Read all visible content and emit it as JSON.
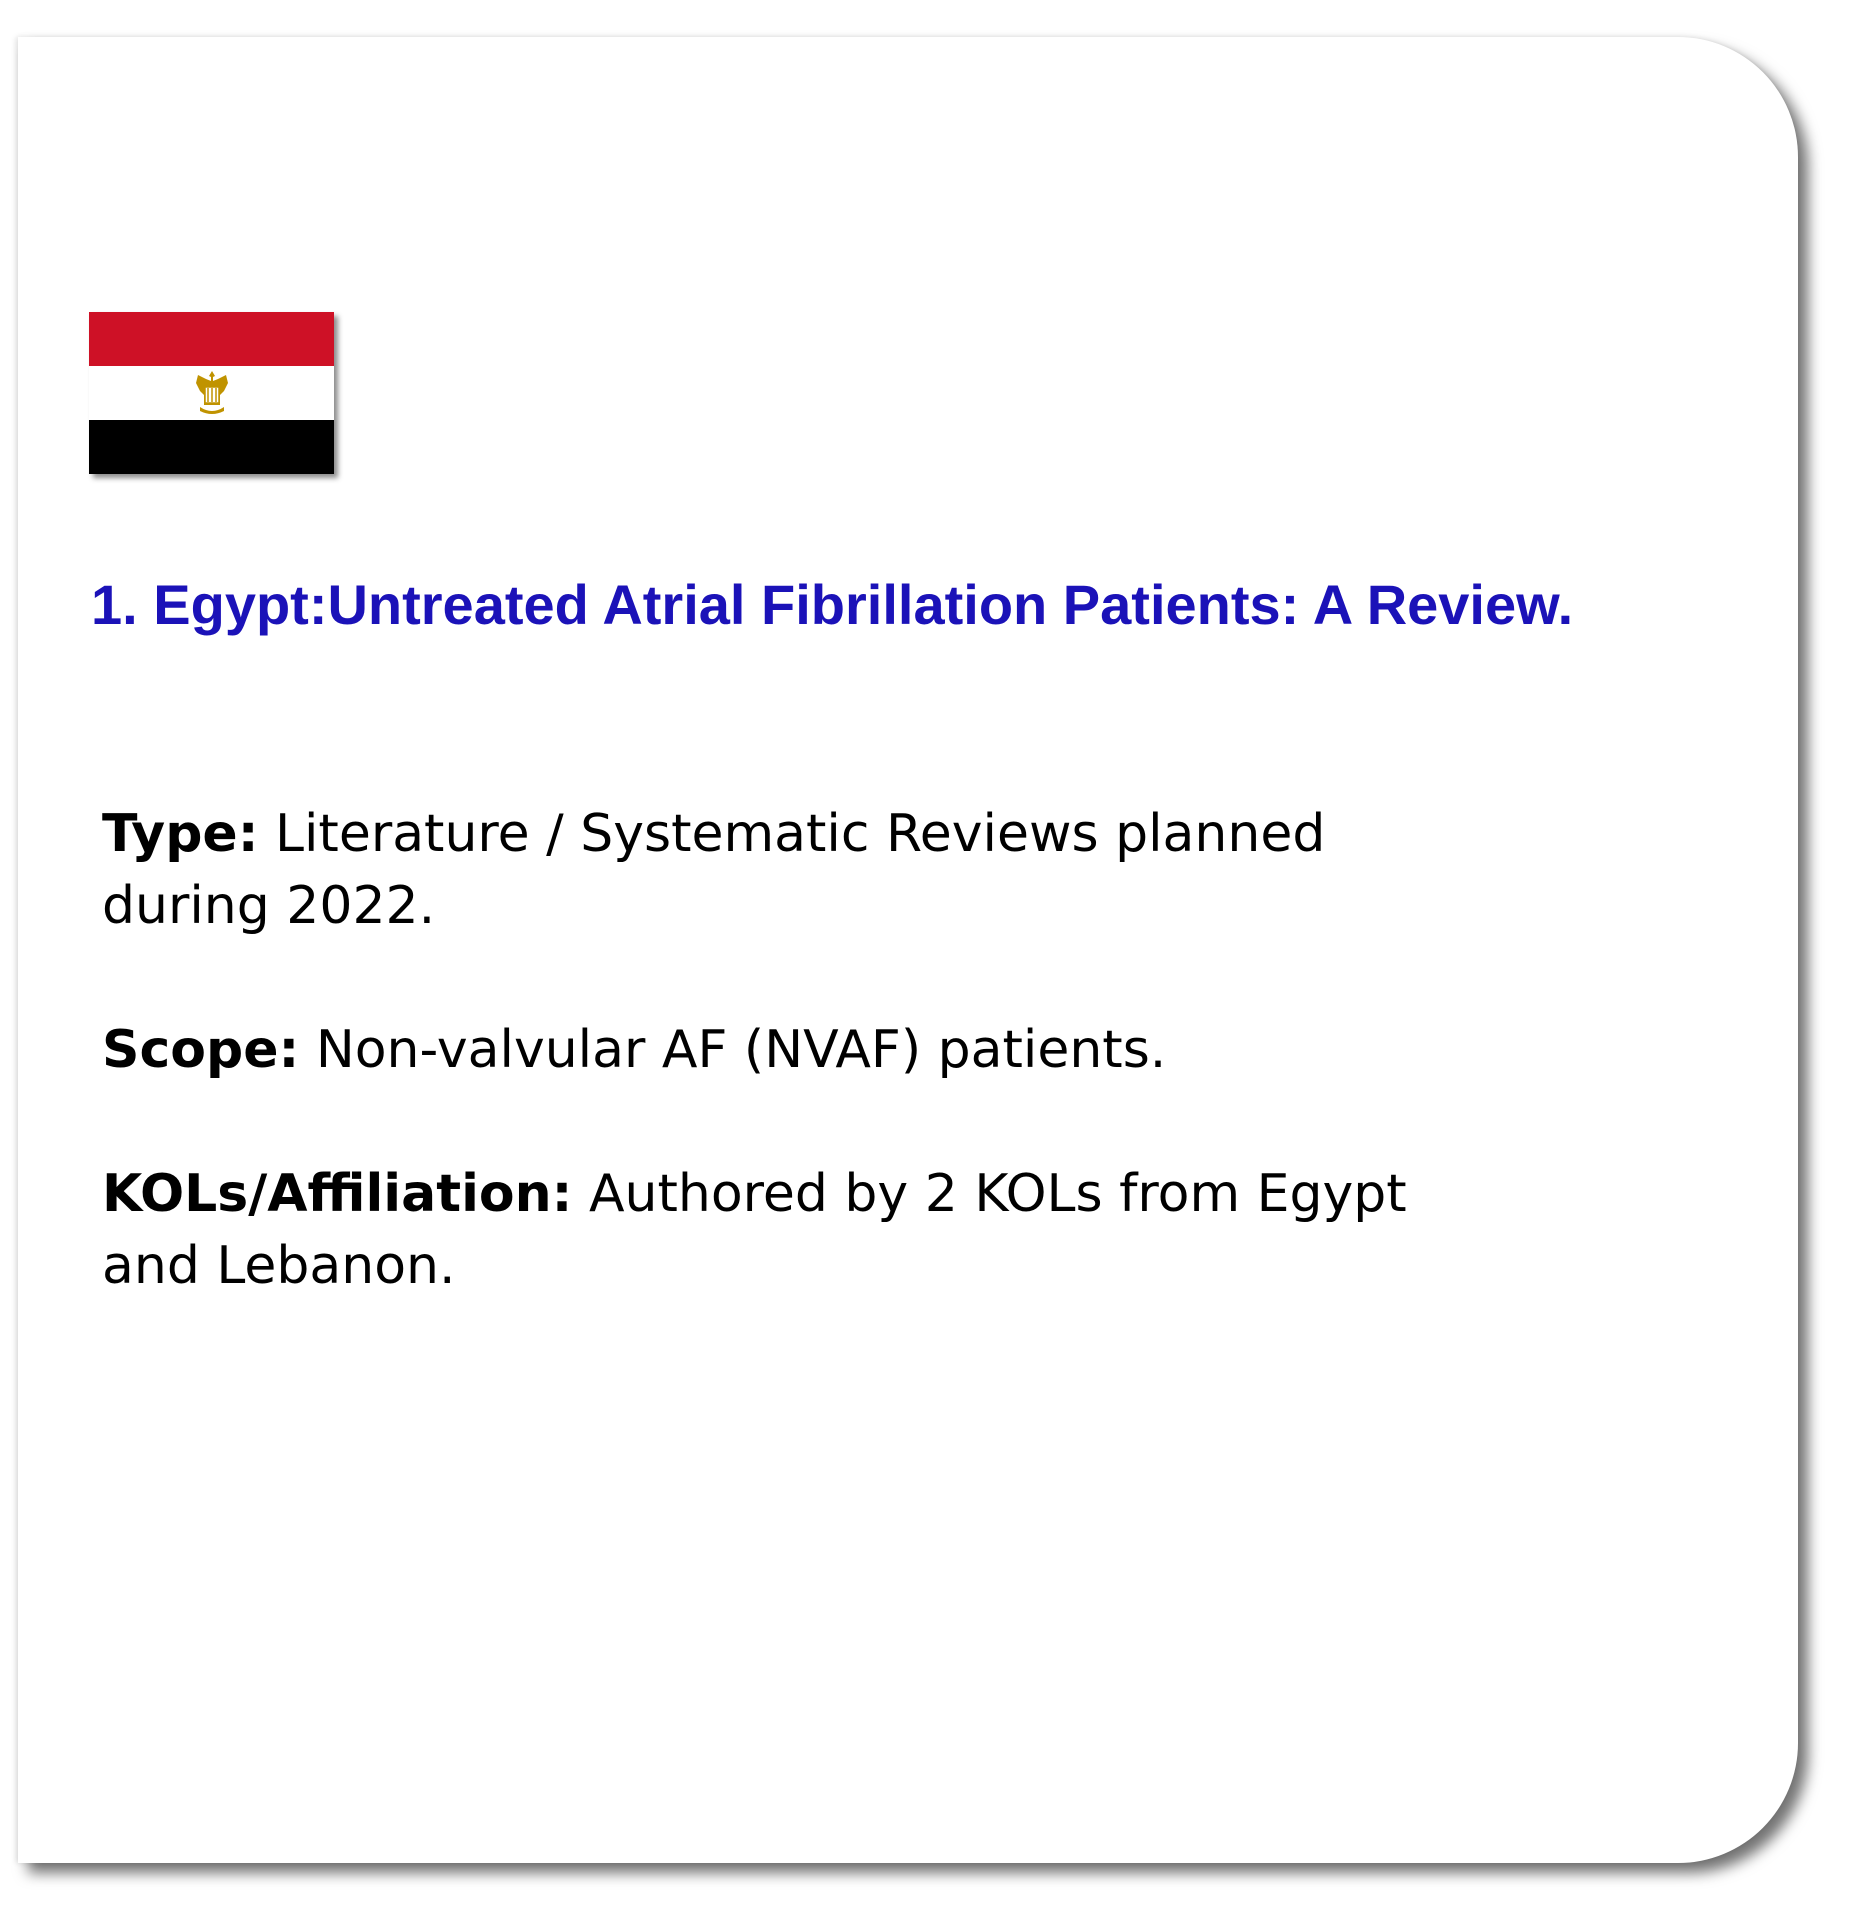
{
  "flag": {
    "country": "Egypt",
    "icon": "egypt-flag-icon",
    "colors": [
      "#ce1126",
      "#ffffff",
      "#000000"
    ],
    "emblem_color": "#c09300"
  },
  "title": "1. Egypt:Untreated Atrial Fibrillation Patients: A Review.",
  "details": {
    "type_label": "Type:",
    "type_line1": "Literature / Systematic Reviews planned",
    "type_line2": "during 2022.",
    "scope_label": "Scope:",
    "scope_value": "Non-valvular AF (NVAF) patients.",
    "kols_label": "KOLs/Affiliation:",
    "kols_line1": "Authored by 2 KOLs from Egypt",
    "kols_line2": "and Lebanon."
  },
  "colors": {
    "title": "#1b12b8",
    "text": "#000000"
  }
}
